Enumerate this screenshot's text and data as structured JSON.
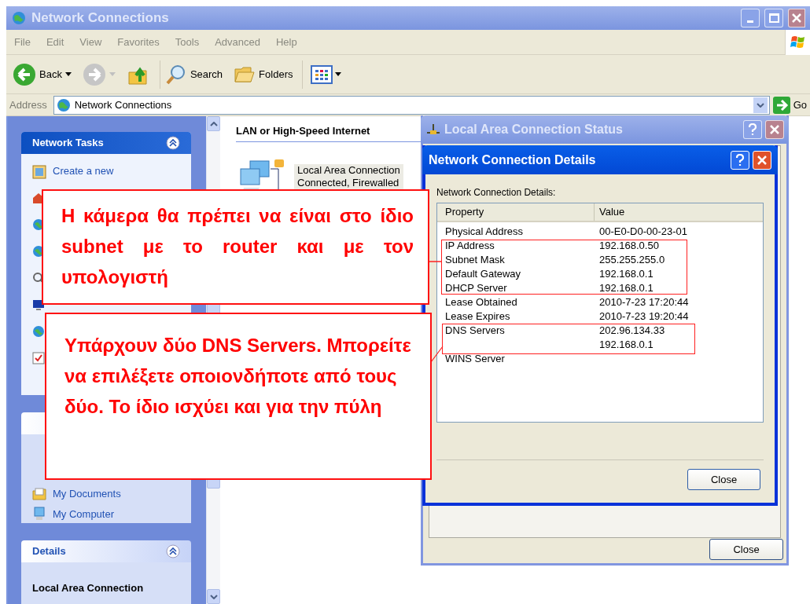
{
  "window": {
    "title": "Network Connections"
  },
  "menu": [
    "File",
    "Edit",
    "View",
    "Favorites",
    "Tools",
    "Advanced",
    "Help"
  ],
  "toolbar": {
    "back": "Back",
    "search": "Search",
    "folders": "Folders"
  },
  "address": {
    "label": "Address",
    "value": "Network Connections",
    "go": "Go"
  },
  "network_tasks": {
    "title": "Network Tasks",
    "items": [
      "Create a new"
    ]
  },
  "other_places": {
    "items": [
      "My Documents",
      "My Computer"
    ]
  },
  "details_panel": {
    "title": "Details",
    "subtitle": "Local Area Connection"
  },
  "content": {
    "group": "LAN or High-Speed Internet",
    "connection_name": "Local Area Connection",
    "connection_status": "Connected, Firewalled"
  },
  "status_dialog": {
    "title": "Local Area Connection Status",
    "close": "Close"
  },
  "details_dialog": {
    "title": "Network Connection Details",
    "label": "Network Connection Details:",
    "columns": [
      "Property",
      "Value"
    ],
    "rows": [
      {
        "property": "Physical Address",
        "value": "00-E0-D0-00-23-01"
      },
      {
        "property": "IP Address",
        "value": "192.168.0.50"
      },
      {
        "property": "Subnet Mask",
        "value": "255.255.255.0"
      },
      {
        "property": "Default Gateway",
        "value": "192.168.0.1"
      },
      {
        "property": "DHCP Server",
        "value": "192.168.0.1"
      },
      {
        "property": "Lease Obtained",
        "value": "2010-7-23 17:20:44"
      },
      {
        "property": "Lease Expires",
        "value": "2010-7-23 19:20:44"
      },
      {
        "property": "DNS Servers",
        "value": "202.96.134.33"
      },
      {
        "value": "192.168.0.1"
      },
      {
        "property": "WINS Server"
      }
    ],
    "close": "Close"
  },
  "callouts": [
    {
      "text": "Η κάμερα θα πρέπει να είναι στο ίδιο subnet με το router και με τον υπολογιστή"
    },
    {
      "text": "Υπάρχουν δύο DNS Servers. Μπορείτε να επιλέξετε οποιονδήποτε από τους δύο. Το ίδιο ισχύει και για την πύλη"
    }
  ]
}
